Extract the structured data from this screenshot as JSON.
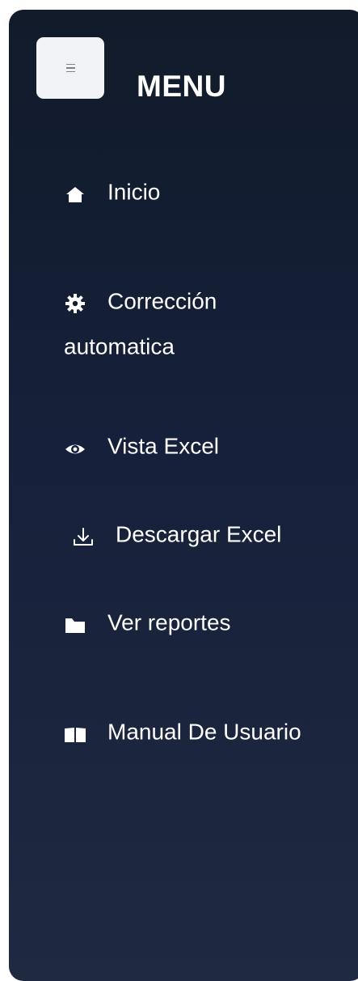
{
  "menu": {
    "title": "MENU",
    "toggle_icon": "hamburger-icon"
  },
  "nav": [
    {
      "label": "Inicio",
      "icon": "home-icon"
    },
    {
      "label": "Corrección automatica",
      "icon": "gear-icon"
    },
    {
      "label": "Vista Excel",
      "icon": "eye-icon"
    },
    {
      "label": "Descargar Excel",
      "icon": "download-icon"
    },
    {
      "label": "Ver reportes",
      "icon": "folder-icon"
    },
    {
      "label": "Manual De Usuario",
      "icon": "book-icon"
    }
  ],
  "colors": {
    "sidebar_top": "#111b2a",
    "sidebar_bottom": "#1f2940",
    "text": "#ffffff",
    "toggle_bg": "#f1f3f6"
  }
}
